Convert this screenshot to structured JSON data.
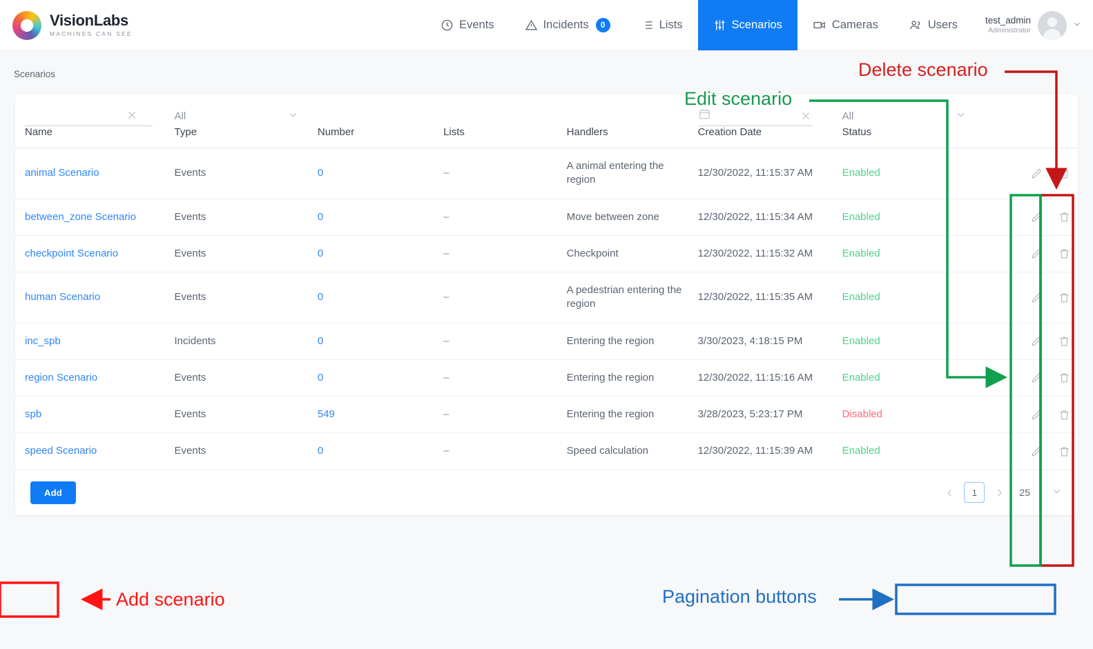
{
  "brand": {
    "name": "VisionLabs",
    "tagline": "MACHINES CAN SEE"
  },
  "nav": {
    "items": [
      {
        "label": "Events",
        "icon": "clock-icon",
        "active": false,
        "badge": null
      },
      {
        "label": "Incidents",
        "icon": "warning-triangle-icon",
        "active": false,
        "badge": "0"
      },
      {
        "label": "Lists",
        "icon": "list-icon",
        "active": false,
        "badge": null
      },
      {
        "label": "Scenarios",
        "icon": "sliders-icon",
        "active": true,
        "badge": null
      },
      {
        "label": "Cameras",
        "icon": "video-camera-icon",
        "active": false,
        "badge": null
      },
      {
        "label": "Users",
        "icon": "users-icon",
        "active": false,
        "badge": null
      }
    ],
    "accent_color": "#0f7cf5"
  },
  "user": {
    "name": "test_admin",
    "role": "Administrator",
    "avatar": "user-avatar-icon",
    "caret": "chevron-down-icon"
  },
  "page": {
    "title": "Scenarios"
  },
  "filters": {
    "name": {
      "value": "",
      "placeholder": "",
      "clear_icon": "close-icon"
    },
    "type": {
      "value": "All",
      "chevron": "chevron-down-icon"
    },
    "creation_date": {
      "value": "",
      "placeholder": "",
      "calendar_icon": "calendar-icon",
      "clear_icon": "close-icon"
    },
    "status": {
      "value": "All",
      "chevron": "chevron-down-icon"
    }
  },
  "table": {
    "columns": [
      "Name",
      "Type",
      "Number",
      "Lists",
      "Handlers",
      "Creation Date",
      "Status"
    ],
    "row_actions": {
      "edit_icon": "pencil-icon",
      "delete_icon": "trash-icon"
    },
    "rows": [
      {
        "name": "animal Scenario",
        "type": "Events",
        "number": "0",
        "lists": "–",
        "handlers": "A animal entering the region",
        "created": "12/30/2022, 11:15:37 AM",
        "status": "Enabled"
      },
      {
        "name": "between_zone Scenario",
        "type": "Events",
        "number": "0",
        "lists": "–",
        "handlers": "Move between zone",
        "created": "12/30/2022, 11:15:34 AM",
        "status": "Enabled"
      },
      {
        "name": "checkpoint Scenario",
        "type": "Events",
        "number": "0",
        "lists": "–",
        "handlers": "Checkpoint",
        "created": "12/30/2022, 11:15:32 AM",
        "status": "Enabled"
      },
      {
        "name": "human Scenario",
        "type": "Events",
        "number": "0",
        "lists": "–",
        "handlers": "A pedestrian entering the region",
        "created": "12/30/2022, 11:15:35 AM",
        "status": "Enabled"
      },
      {
        "name": "inc_spb",
        "type": "Incidents",
        "number": "0",
        "lists": "–",
        "handlers": "Entering the region",
        "created": "3/30/2023, 4:18:15 PM",
        "status": "Enabled"
      },
      {
        "name": "region Scenario",
        "type": "Events",
        "number": "0",
        "lists": "–",
        "handlers": "Entering the region",
        "created": "12/30/2022, 11:15:16 AM",
        "status": "Enabled"
      },
      {
        "name": "spb",
        "type": "Events",
        "number": "549",
        "lists": "–",
        "handlers": "Entering the region",
        "created": "3/28/2023, 5:23:17 PM",
        "status": "Disabled"
      },
      {
        "name": "speed Scenario",
        "type": "Events",
        "number": "0",
        "lists": "–",
        "handlers": "Speed calculation",
        "created": "12/30/2022, 11:15:39 AM",
        "status": "Enabled"
      }
    ]
  },
  "footer": {
    "add_label": "Add",
    "pagination": {
      "prev_icon": "chevron-left-icon",
      "next_icon": "chevron-right-icon",
      "current_page": "1",
      "page_size": "25",
      "size_chevron": "chevron-down-icon"
    }
  },
  "annotations": [
    {
      "text": "Delete scenario",
      "color": "#d42020"
    },
    {
      "text": "Edit scenario",
      "color": "#1a9850"
    },
    {
      "text": "Add scenario",
      "color": "#ff1414"
    },
    {
      "text": "Pagination buttons",
      "color": "#1f6fc4"
    }
  ],
  "status_colors": {
    "enabled": "#4cd38a",
    "disabled": "#ff6b7a",
    "link": "#2f86f6"
  }
}
